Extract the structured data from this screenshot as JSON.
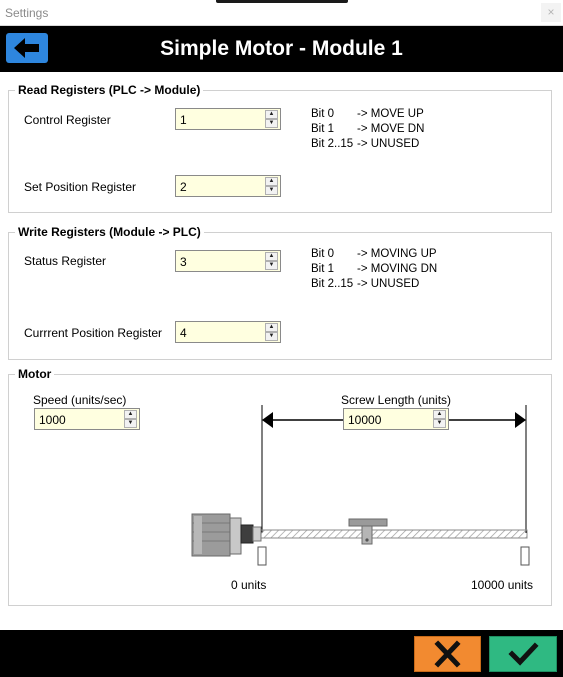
{
  "window": {
    "title": "Settings",
    "close_glyph": "×"
  },
  "header": {
    "title": "Simple Motor - Module 1",
    "back_icon": "arrow-left-icon"
  },
  "read_registers": {
    "title": "Read Registers (PLC -> Module)",
    "control": {
      "label": "Control Register",
      "value": "1"
    },
    "set_position": {
      "label": "Set Position Register",
      "value": "2"
    },
    "bits": [
      {
        "bit": "Bit 0",
        "desc": "-> MOVE UP"
      },
      {
        "bit": "Bit 1",
        "desc": "-> MOVE DN"
      },
      {
        "bit": "Bit 2..15",
        "desc": "-> UNUSED"
      }
    ]
  },
  "write_registers": {
    "title": "Write Registers (Module -> PLC)",
    "status": {
      "label": "Status Register",
      "value": "3"
    },
    "current_position": {
      "label": "Currrent Position Register",
      "value": "4"
    },
    "bits": [
      {
        "bit": "Bit 0",
        "desc": "-> MOVING UP"
      },
      {
        "bit": "Bit 1",
        "desc": "-> MOVING DN"
      },
      {
        "bit": "Bit 2..15",
        "desc": "-> UNUSED"
      }
    ]
  },
  "motor": {
    "title": "Motor",
    "speed": {
      "label": "Speed (units/sec)",
      "value": "1000"
    },
    "screw_length": {
      "label": "Screw Length (units)",
      "value": "10000"
    },
    "start_label": "0 units",
    "end_label": "10000 units"
  },
  "footer": {
    "cancel_icon": "x-icon",
    "ok_icon": "checkmark-icon"
  },
  "colors": {
    "accent_blue": "#2e86de",
    "cancel_orange": "#f28a30",
    "ok_green": "#2fb982",
    "input_bg": "#ffffe0"
  }
}
